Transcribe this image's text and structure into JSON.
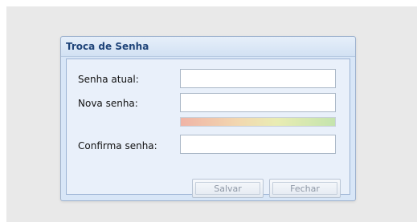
{
  "dialog": {
    "title": "Troca de Senha",
    "fields": {
      "current_password_label": "Senha atual:",
      "new_password_label": "Nova senha:",
      "confirm_password_label": "Confirma senha:"
    },
    "buttons": {
      "save_label": "Salvar",
      "close_label": "Fechar"
    }
  }
}
